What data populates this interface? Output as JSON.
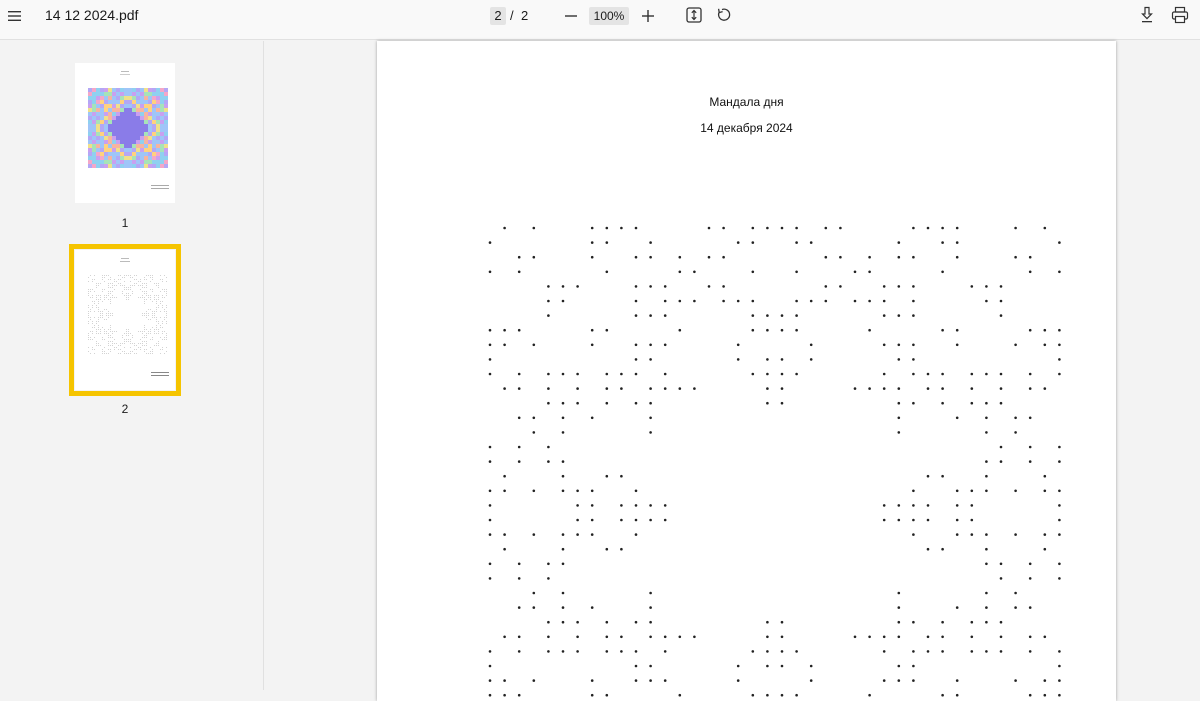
{
  "toolbar": {
    "menu_icon": "hamburger-menu-icon",
    "file_name": "14 12 2024.pdf",
    "current_page": "2",
    "page_separator": "/",
    "total_pages": "2",
    "zoom_level": "100%",
    "zoom_out_icon": "minus-icon",
    "zoom_in_icon": "plus-icon",
    "fit_page_icon": "fit-to-page-icon",
    "rotate_icon": "rotate-icon",
    "download_icon": "download-icon",
    "print_icon": "print-icon"
  },
  "sidebar": {
    "thumbnails": [
      {
        "label": "1",
        "selected": false
      },
      {
        "label": "2",
        "selected": true
      }
    ],
    "selection_color": "#f5c400"
  },
  "page": {
    "title": "Мандала дня",
    "date": "14 декабря 2024"
  }
}
